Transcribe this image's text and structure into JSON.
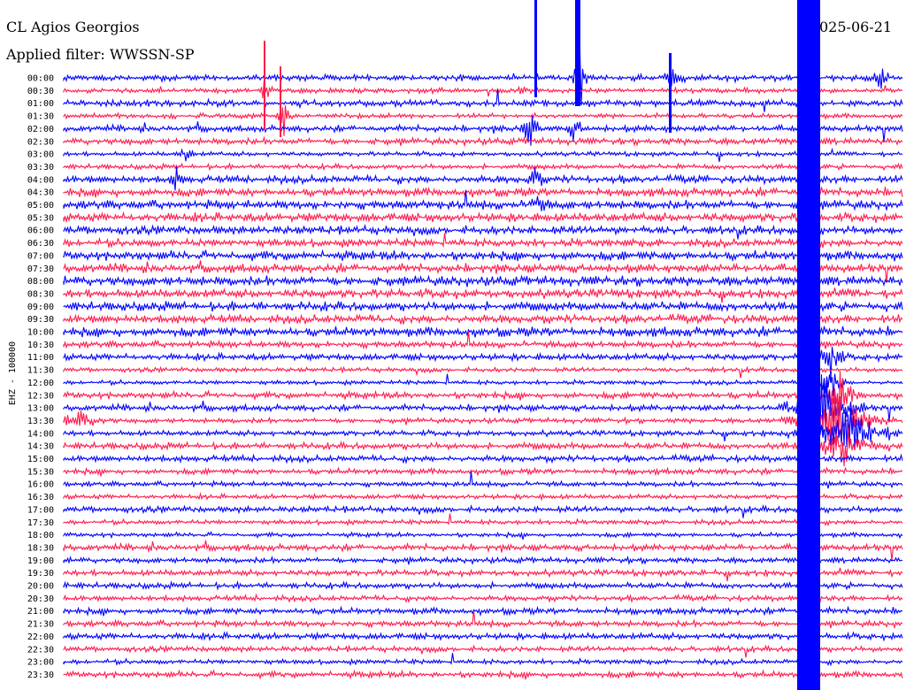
{
  "header": {
    "station": "CL Agios Georgios",
    "filter": "Applied filter: WWSSN-SP",
    "date": "025-06-21"
  },
  "axis": {
    "channel_label": "EHZ - 100000"
  },
  "colors": {
    "trace_a": "#0000ff",
    "trace_b": "#ff1a4d",
    "background": "#ffffff",
    "text": "#000000"
  },
  "chart_data": {
    "type": "helicorder",
    "row_labels": [
      "00:00",
      "00:30",
      "01:00",
      "01:30",
      "02:00",
      "02:30",
      "03:00",
      "03:30",
      "04:00",
      "04:30",
      "05:00",
      "05:30",
      "06:00",
      "06:30",
      "07:00",
      "07:30",
      "08:00",
      "08:30",
      "09:00",
      "09:30",
      "10:00",
      "10:30",
      "11:00",
      "11:30",
      "12:00",
      "12:30",
      "13:00",
      "13:30",
      "14:00",
      "14:30",
      "15:00",
      "15:30",
      "16:00",
      "16:30",
      "17:00",
      "17:30",
      "18:00",
      "18:30",
      "19:00",
      "19:30",
      "20:00",
      "20:30",
      "21:00",
      "21:30",
      "22:00",
      "22:30",
      "23:00",
      "23:30"
    ],
    "visible_row_labels": [
      "00:00",
      "00:30",
      "01:00",
      "01:30",
      "02:00",
      "02:30",
      "03:00",
      "03:30",
      "04:00",
      "04:30",
      "05:00",
      "05:30",
      "06:00",
      "06:30",
      "07:00",
      "07:30",
      "08:00",
      "08:30",
      "09:00",
      "09:30",
      "10:00",
      "10:30",
      "11:00",
      "11:30",
      "12:00",
      "12:30",
      "13:00",
      "13:30",
      "14:00",
      "14:30",
      "15:00",
      "15:30",
      "16:00",
      "16:30",
      "17:00",
      "17:30",
      "18:00",
      "18:30",
      "19:00",
      "19:30",
      "20:00",
      "20:30",
      "21:00",
      "21:30",
      "22:00",
      "22:30",
      "23:00",
      "23:30"
    ],
    "trace_color_order": [
      "trace_a",
      "trace_b"
    ]
  }
}
